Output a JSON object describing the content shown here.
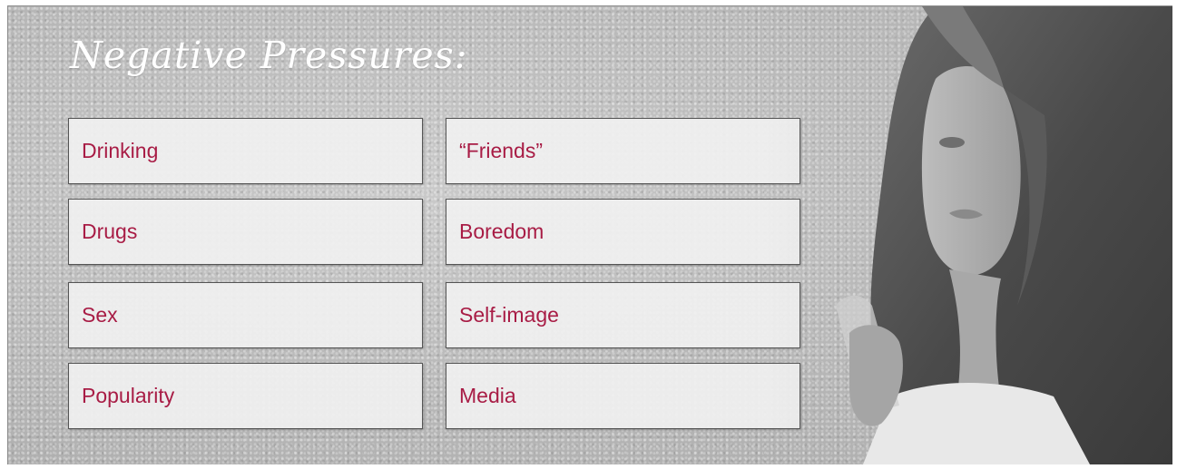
{
  "title": "Negative Pressures:",
  "pressures": [
    {
      "label": "Drinking"
    },
    {
      "label": "“Friends”"
    },
    {
      "label": "Drugs"
    },
    {
      "label": "Boredom"
    },
    {
      "label": "Sex"
    },
    {
      "label": "Self-image"
    },
    {
      "label": "Popularity"
    },
    {
      "label": "Media"
    }
  ],
  "colors": {
    "label_text": "#a81c45",
    "title_text": "#ffffff",
    "box_fill": "#f0f0f0",
    "box_border": "#555555",
    "background": "#b9b9b9"
  },
  "photo": {
    "icon": "teen-girl-photo"
  }
}
